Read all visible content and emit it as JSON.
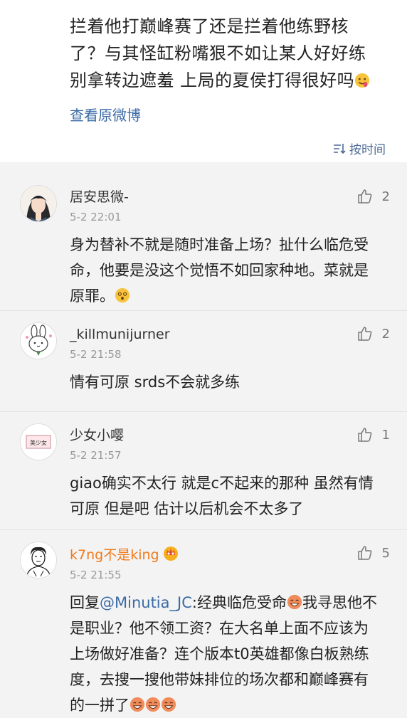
{
  "post": {
    "text_lines": [
      "拦着他打巅峰赛了还是拦着他练野核",
      "了？与其怪缸粉嘴狠不如让某人好好练",
      "别拿转边遮羞 上局的夏侯打得很好吗"
    ],
    "view_original": "查看原微博",
    "sort_label": "按时间"
  },
  "comments": [
    {
      "name": "居安思微-",
      "time": "5-2 22:01",
      "likes": "2",
      "text": "身为替补不就是随时准备上场？扯什么临危受命，他要是没这个觉悟不如回家种地。菜就是原罪。",
      "avatar_icon": "anime-character-avatar"
    },
    {
      "name": "_killmunijurner",
      "time": "5-2 21:58",
      "likes": "2",
      "text": "情有可原 srds不会就多练",
      "avatar_icon": "bunny-sticker-avatar"
    },
    {
      "name": "少女小嘤",
      "time": "5-2 21:57",
      "likes": "1",
      "text": "giao确实不太行 就是c不起来的那种 虽然有情可原 但是吧 估计以后机会不太多了",
      "avatar_icon": "text-card-avatar",
      "avatar_text": "美少女"
    },
    {
      "name": "k7ng不是king",
      "time": "5-2 21:55",
      "likes": "5",
      "reply_prefix": "回复",
      "mention": "@Minutia_JC",
      "text_a": ":经典临危受命",
      "text_b": "我寻思他不是职业？他不领工资？在大名单上面不应该为上场做好准备？连个版本t0英雄都像白板熟练度，去搜一搜他带妹排位的场次都和巅峰赛有的一拼了",
      "avatar_icon": "sketch-man-avatar"
    }
  ],
  "colors": {
    "link": "#3a6aa6",
    "vip_name": "#f07a1b",
    "background": "#f3f3f3"
  }
}
